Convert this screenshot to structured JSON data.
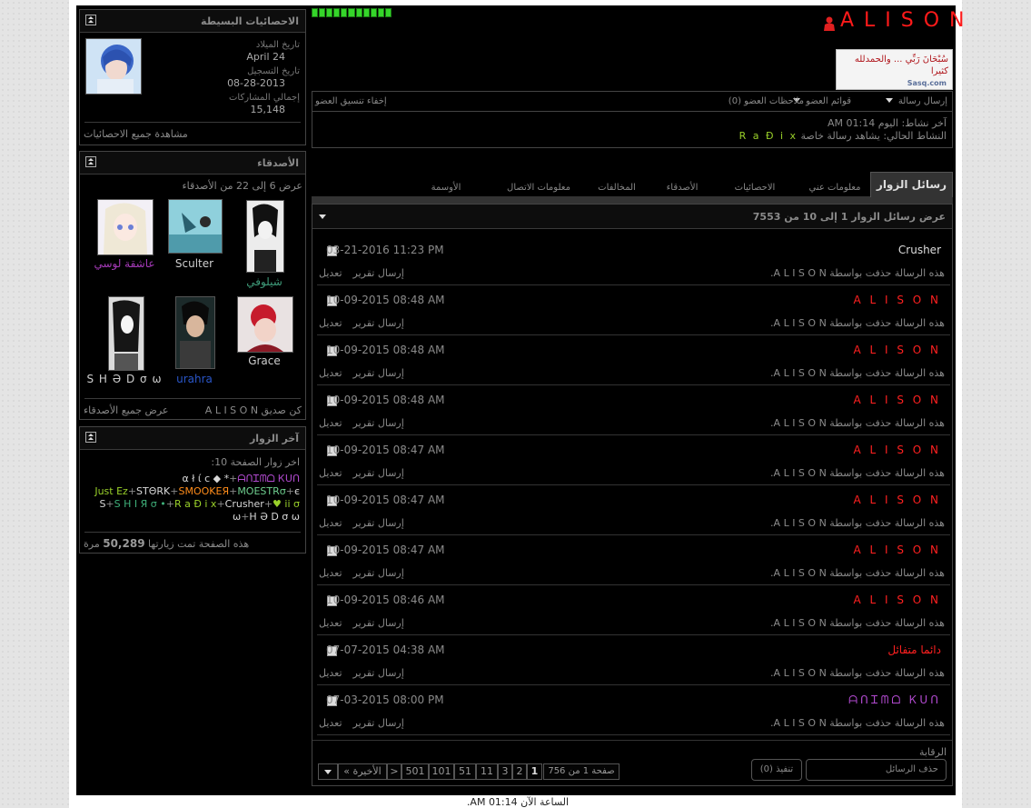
{
  "profile": {
    "username": "A L I S O N",
    "user_title_image_text": "سُبْحَانَ رَبِّي ... والحمدلله كثيرا",
    "user_title_image_site": "Sasq.com",
    "menu": {
      "send_message": "إرسال رسالة",
      "member_lists": "قوائم العضو",
      "member_notes": "ملاحظات العضو (0)",
      "hide_style": "إخفاء تنسيق العضو"
    },
    "last_activity": "آخر نشاط: اليوم 01:14 AM",
    "current_activity_label": "النشاط الحالي: يشاهد رسالة خاصة",
    "current_activity_user": "R a Đ i x"
  },
  "mini_stats": {
    "title": "الاحصائيات البسيطة",
    "birth_label": "تاريخ الميلاد",
    "birth_value": "April 24",
    "join_label": "تاريخ التسجيل",
    "join_value": "08-28-2013",
    "posts_label": "إجمالي المشاركات",
    "posts_value": "15,148",
    "view_all": "مشاهدة جميع الاحصائيات"
  },
  "friends": {
    "title": "الأصدقاء",
    "range": "عرض 6 إلى 22 من الأصدقاء",
    "list": [
      {
        "name": "شيلوفي",
        "color": "#3f9c7a"
      },
      {
        "name": "Sculter",
        "color": "#cfcfcf"
      },
      {
        "name": "عاشقة لوسي",
        "color": "#a53ab8"
      },
      {
        "name": "Grace",
        "color": "#cfcfcf"
      },
      {
        "name": "urahra",
        "color": "#2a56c9"
      },
      {
        "name": "S H Ә D σ ω",
        "color": "#cfcfcf"
      }
    ],
    "be_friend": "كن صديق A L I S O N",
    "view_all": "عرض جميع الأصدقاء"
  },
  "visitors": {
    "title": "آخر الزوار",
    "last10": "اخر زوار الصفحة 10:",
    "names": [
      {
        "name": "ᗩᑎᏆᗰᗝ Ꮶᑌᑎ",
        "color": "#b24ad0"
      },
      {
        "name": "* ◆ α ł ί c є",
        "color": "#d8d8d8"
      },
      {
        "name": "MOESTRσ",
        "color": "#6fcf8f"
      },
      {
        "name": "SMOOKEЯ",
        "color": "#ff8c1a"
      },
      {
        "name": "STΘRK",
        "color": "#d8d8d8"
      },
      {
        "name": "Just Ez ii σ ♥",
        "color": "#9ad12a"
      },
      {
        "name": "Crusher",
        "color": "#d8d8d8"
      },
      {
        "name": "R a Đ i x",
        "color": "#9ad12a"
      },
      {
        "name": "• S H I Я σ",
        "color": "#3fb07a"
      },
      {
        "name": "S H Ә D σ ω",
        "color": "#d8d8d8"
      },
      {
        "name": "ω",
        "color": "#d8d8d8"
      }
    ],
    "count_prefix": "هذه الصفحة تمت زيارتها",
    "count": "50,289",
    "count_suffix": "مرة"
  },
  "tabs": {
    "active": "رسائل الزوار",
    "others": [
      "معلومات عني",
      "الاحصائيات",
      "الأصدقاء",
      "المخالفات",
      "معلومات الاتصال",
      "الأوسمة"
    ]
  },
  "messages_header": "عرض رسائل الزوار 1 إلى 10 من 7553",
  "messages": [
    {
      "sender": "Crusher",
      "color": "#dddddd",
      "date": "03-21-2016",
      "time": "11:23 PM"
    },
    {
      "sender": "A L I S O N",
      "color": "#ff2020",
      "date": "10-09-2015",
      "time": "08:48 AM"
    },
    {
      "sender": "A L I S O N",
      "color": "#ff2020",
      "date": "10-09-2015",
      "time": "08:48 AM"
    },
    {
      "sender": "A L I S O N",
      "color": "#ff2020",
      "date": "10-09-2015",
      "time": "08:48 AM"
    },
    {
      "sender": "A L I S O N",
      "color": "#ff2020",
      "date": "10-09-2015",
      "time": "08:47 AM"
    },
    {
      "sender": "A L I S O N",
      "color": "#ff2020",
      "date": "10-09-2015",
      "time": "08:47 AM"
    },
    {
      "sender": "A L I S O N",
      "color": "#ff2020",
      "date": "10-09-2015",
      "time": "08:47 AM"
    },
    {
      "sender": "A L I S O N",
      "color": "#ff2020",
      "date": "10-09-2015",
      "time": "08:46 AM"
    },
    {
      "sender": "دائما متفائل",
      "color": "#ff2020",
      "date": "07-07-2015",
      "time": "04:38 AM"
    },
    {
      "sender": "ᗩᑎᏆᗰᗝ Ꮶᑌᑎ",
      "color": "#b24ad0",
      "date": "07-03-2015",
      "time": "08:00 PM"
    }
  ],
  "message_body": "هذه الرسالة حذفت بواسطة A L I S O N.",
  "report_link": "إرسال تقرير",
  "edit_link": "تعديل",
  "moderation": {
    "label": "الرقابة",
    "select_value": "حذف الرسائل",
    "execute": "(0) تنفيذ"
  },
  "pagination": {
    "page_of": "صفحة 1 من 756",
    "pages": [
      "1",
      "2",
      "3",
      "11",
      "51",
      "101",
      "501"
    ],
    "next": ">",
    "last": "الأخيرة »"
  },
  "footer_time": "الساعة الآن 01:14 AM."
}
